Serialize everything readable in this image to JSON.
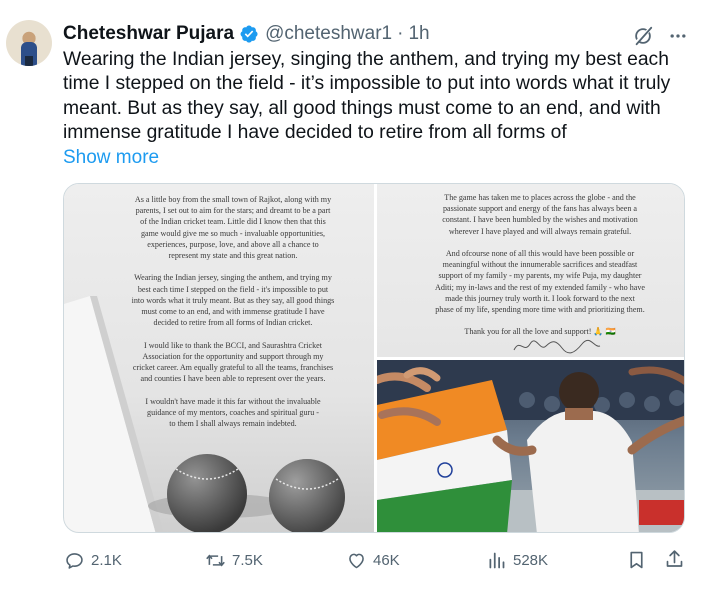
{
  "author": {
    "name": "Cheteshwar Pujara",
    "handle": "@cheteshwar1",
    "separator": "·",
    "time": "1h"
  },
  "tweet": {
    "text": "Wearing the Indian jersey, singing the anthem, and trying my best each time I stepped on the field - it’s impossible to put into words what it truly meant. But as they say, all good things must come to an end, and with immense gratitude I have decided to retire from all forms of",
    "show_more": "Show more"
  },
  "media": {
    "letter_page_1": "As a little boy from the small town of Rajkot, along with my\nparents, I set out to aim for the stars; and dreamt to be a part\nof the Indian cricket team. Little did I know then that this\ngame would give me so much - invaluable opportunities,\nexperiences, purpose, love, and above all a chance to\nrepresent my state and this great nation.\n\nWearing the Indian jersey, singing the anthem, and trying my\nbest each time I stepped on the field - it's impossible to put\ninto words what it truly meant. But as they say, all good things\nmust come to an end, and with immense gratitude I have\ndecided to retire from all forms of Indian cricket.\n\nI would like to thank the BCCI, and Saurashtra Cricket\nAssociation for the opportunity and support through my\ncricket career. Am equally grateful to all the teams, franchises\nand counties I have been able to represent over the years.\n\nI wouldn't have made it this far without the invaluable\nguidance of my mentors, coaches and spiritual guru -\nto them I shall always remain indebted.",
    "letter_page_2": "The game has taken me to places across the globe - and the\npassionate support and energy of the fans has always been a\nconstant. I have been humbled by the wishes and motivation\nwherever I have played and will always remain grateful.\n\nAnd ofcourse none of all this would have been possible or\nmeaningful without the innumerable sacrifices and steadfast\nsupport of my family - my parents, my wife Puja, my daughter\nAditi; my in-laws and the rest of my extended family - who have\nmade this journey truly worth it. I look forward to the next\nphase of my life, spending more time with and prioritizing them.\n\nThank you for all the love and support! 🙏 🇮🇳"
  },
  "stats": {
    "replies": "2.1K",
    "reposts": "7.5K",
    "likes": "46K",
    "views": "528K"
  },
  "icons": {
    "verified": "verified-badge-icon",
    "grok": "grok-icon",
    "more": "more-icon",
    "reply": "reply-icon",
    "repost": "repost-icon",
    "like": "like-icon",
    "views": "views-icon",
    "bookmark": "bookmark-icon",
    "share": "share-icon"
  },
  "colors": {
    "accent": "#1d9bf0",
    "secondary_text": "#536471",
    "primary_text": "#0f1419"
  }
}
